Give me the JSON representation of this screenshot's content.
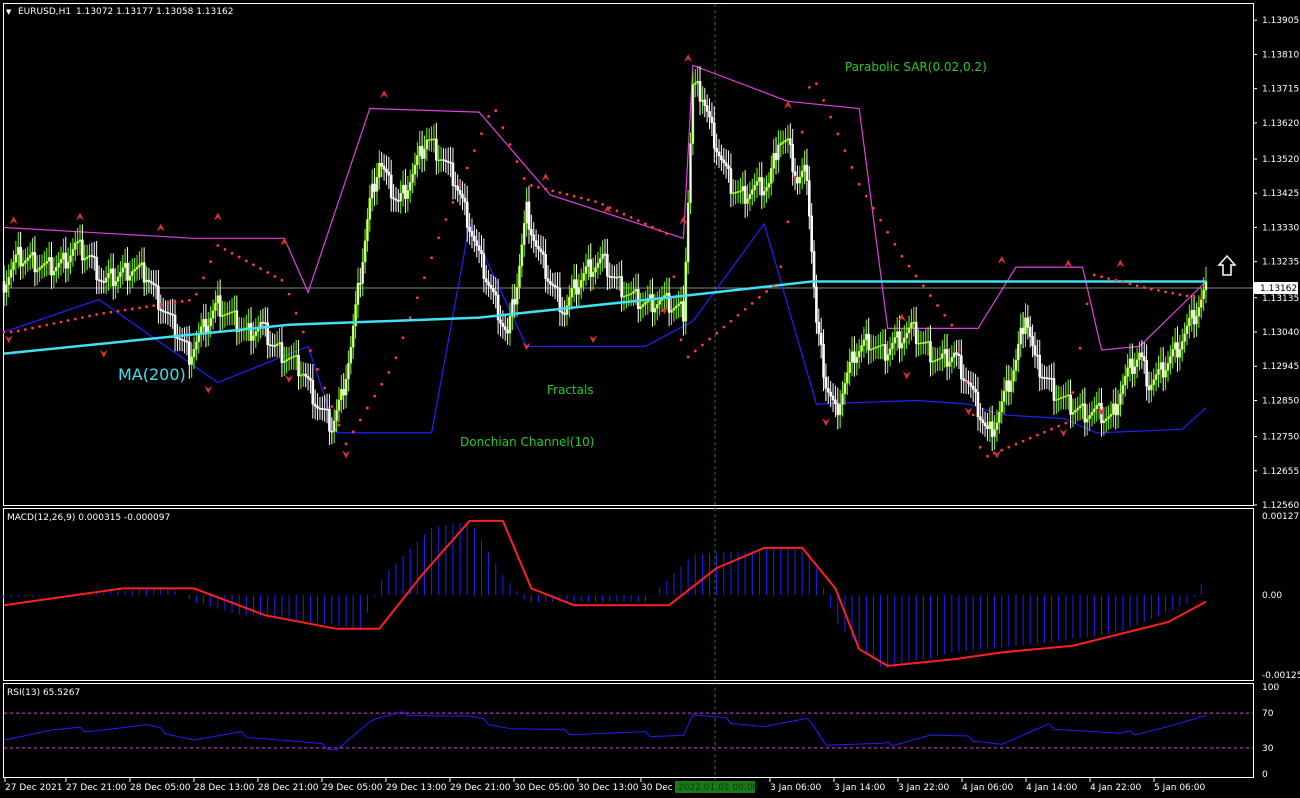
{
  "header": {
    "symbol": "EURUSD,H1",
    "ohlc": "1.13072 1.13177 1.13058 1.13162"
  },
  "colors": {
    "bull": "#7CFC00",
    "bear": "#FFFFFF",
    "ma": "#40E0F0",
    "sar": "#FF3B3B",
    "donchian_upper": "#E040E0",
    "donchian_lower": "#2020FF",
    "macd_hist": "#2020FF",
    "macd_signal": "#FF2020",
    "rsi": "#2020FF",
    "level": "#E040E0",
    "fractal": "#E03030",
    "label_green": "#22CC22",
    "grid_border": "#FFFFFF"
  },
  "chart_data": [
    {
      "type": "candlestick",
      "title": "EURUSD,H1",
      "ylim": [
        1.1256,
        1.1395
      ],
      "y_ticks": [
        "1.13905",
        "1.13810",
        "1.13715",
        "1.13620",
        "1.13520",
        "1.13425",
        "1.13330",
        "1.13235",
        "1.13135",
        "1.13040",
        "1.12945",
        "1.12850",
        "1.12750",
        "1.12655",
        "1.12560"
      ],
      "current_price": "1.13162",
      "x_ticks": [
        "27 Dec 2021",
        "27 Dec 21:00",
        "28 Dec 05:00",
        "28 Dec 13:00",
        "28 Dec 21:00",
        "29 Dec 05:00",
        "29 Dec 13:00",
        "29 Dec 21:00",
        "30 Dec 05:00",
        "30 Dec 13:00",
        "30 Dec",
        "3 Jan 06:00",
        "3 Jan 14:00",
        "3 Jan 22:00",
        "4 Jan 06:00",
        "4 Jan 14:00",
        "4 Jan 22:00",
        "5 Jan 06:00"
      ],
      "cursor_time": "2022.01.01 00:00",
      "indicator_labels": {
        "ma": "MA(200)",
        "sar": "Parabolic SAR(0.02,0.2)",
        "fractals": "Fractals",
        "donchian": "Donchian Channel(10)"
      },
      "close_path": [
        [
          0,
          1.1318
        ],
        [
          6,
          1.1325
        ],
        [
          12,
          1.1324
        ],
        [
          18,
          1.1322
        ],
        [
          24,
          1.1323
        ],
        [
          30,
          1.1328
        ],
        [
          36,
          1.1325
        ],
        [
          42,
          1.1318
        ],
        [
          48,
          1.132
        ],
        [
          54,
          1.1322
        ],
        [
          60,
          1.132
        ],
        [
          66,
          1.1312
        ],
        [
          72,
          1.1305
        ],
        [
          78,
          1.1298
        ],
        [
          84,
          1.1305
        ],
        [
          90,
          1.1312
        ],
        [
          96,
          1.1308
        ],
        [
          102,
          1.1304
        ],
        [
          108,
          1.1306
        ],
        [
          114,
          1.13
        ],
        [
          120,
          1.1297
        ],
        [
          126,
          1.1293
        ],
        [
          132,
          1.1284
        ],
        [
          138,
          1.1278
        ],
        [
          142,
          1.1286
        ],
        [
          146,
          1.13
        ],
        [
          150,
          1.132
        ],
        [
          154,
          1.134
        ],
        [
          158,
          1.1352
        ],
        [
          162,
          1.1345
        ],
        [
          166,
          1.134
        ],
        [
          172,
          1.1348
        ],
        [
          178,
          1.1358
        ],
        [
          184,
          1.1353
        ],
        [
          190,
          1.1346
        ],
        [
          196,
          1.1334
        ],
        [
          200,
          1.1325
        ],
        [
          206,
          1.1314
        ],
        [
          212,
          1.1303
        ],
        [
          216,
          1.1318
        ],
        [
          220,
          1.1338
        ],
        [
          224,
          1.1328
        ],
        [
          230,
          1.1318
        ],
        [
          236,
          1.131
        ],
        [
          240,
          1.1316
        ],
        [
          246,
          1.1322
        ],
        [
          252,
          1.1324
        ],
        [
          258,
          1.1318
        ],
        [
          264,
          1.1314
        ],
        [
          270,
          1.1312
        ],
        [
          276,
          1.1313
        ],
        [
          280,
          1.1312
        ],
        [
          286,
          1.131
        ],
        [
          290,
          1.1372
        ],
        [
          294,
          1.137
        ],
        [
          298,
          1.136
        ],
        [
          302,
          1.1352
        ],
        [
          306,
          1.1345
        ],
        [
          310,
          1.1342
        ],
        [
          316,
          1.1344
        ],
        [
          322,
          1.1345
        ],
        [
          326,
          1.1358
        ],
        [
          330,
          1.1356
        ],
        [
          334,
          1.1346
        ],
        [
          338,
          1.1349
        ],
        [
          342,
          1.1306
        ],
        [
          346,
          1.129
        ],
        [
          350,
          1.1282
        ],
        [
          354,
          1.129
        ],
        [
          358,
          1.1298
        ],
        [
          364,
          1.1302
        ],
        [
          370,
          1.1298
        ],
        [
          376,
          1.1302
        ],
        [
          382,
          1.1305
        ],
        [
          388,
          1.13
        ],
        [
          394,
          1.1296
        ],
        [
          400,
          1.1298
        ],
        [
          406,
          1.129
        ],
        [
          410,
          1.1283
        ],
        [
          414,
          1.1276
        ],
        [
          418,
          1.128
        ],
        [
          422,
          1.1288
        ],
        [
          426,
          1.1296
        ],
        [
          430,
          1.131
        ],
        [
          434,
          1.1296
        ],
        [
          438,
          1.1292
        ],
        [
          442,
          1.1288
        ],
        [
          448,
          1.1284
        ],
        [
          454,
          1.1282
        ],
        [
          460,
          1.1282
        ],
        [
          466,
          1.128
        ],
        [
          470,
          1.1288
        ],
        [
          474,
          1.1294
        ],
        [
          478,
          1.1298
        ],
        [
          482,
          1.129
        ],
        [
          486,
          1.1292
        ],
        [
          490,
          1.1296
        ],
        [
          494,
          1.13
        ],
        [
          498,
          1.1305
        ],
        [
          502,
          1.131
        ],
        [
          506,
          1.1316
        ]
      ],
      "ma200_path": [
        [
          0,
          1.1298
        ],
        [
          120,
          1.1306
        ],
        [
          200,
          1.1308
        ],
        [
          286,
          1.1314
        ],
        [
          340,
          1.1318
        ],
        [
          400,
          1.1318
        ],
        [
          506,
          1.1318
        ]
      ],
      "donchian_upper_path": [
        [
          0,
          1.1333
        ],
        [
          80,
          1.133
        ],
        [
          118,
          1.133
        ],
        [
          128,
          1.1315
        ],
        [
          154,
          1.1366
        ],
        [
          200,
          1.1365
        ],
        [
          230,
          1.1342
        ],
        [
          286,
          1.133
        ],
        [
          290,
          1.1378
        ],
        [
          330,
          1.1368
        ],
        [
          360,
          1.1366
        ],
        [
          372,
          1.1305
        ],
        [
          410,
          1.1305
        ],
        [
          426,
          1.1322
        ],
        [
          454,
          1.1322
        ],
        [
          462,
          1.1299
        ],
        [
          478,
          1.13
        ],
        [
          506,
          1.1318
        ]
      ],
      "donchian_lower_path": [
        [
          0,
          1.1304
        ],
        [
          40,
          1.1313
        ],
        [
          90,
          1.129
        ],
        [
          128,
          1.13
        ],
        [
          140,
          1.1276
        ],
        [
          180,
          1.1276
        ],
        [
          196,
          1.1334
        ],
        [
          220,
          1.13
        ],
        [
          270,
          1.13
        ],
        [
          290,
          1.1307
        ],
        [
          320,
          1.1334
        ],
        [
          342,
          1.1284
        ],
        [
          384,
          1.1285
        ],
        [
          406,
          1.1284
        ],
        [
          420,
          1.1281
        ],
        [
          446,
          1.128
        ],
        [
          460,
          1.1276
        ],
        [
          496,
          1.1277
        ],
        [
          506,
          1.1283
        ]
      ],
      "sar_path": [
        [
          4,
          1.1304
        ],
        [
          40,
          1.1309
        ],
        [
          80,
          1.1313
        ],
        [
          90,
          1.1328
        ],
        [
          118,
          1.1318
        ],
        [
          126,
          1.1304
        ],
        [
          144,
          1.1273
        ],
        [
          164,
          1.1295
        ],
        [
          184,
          1.1332
        ],
        [
          206,
          1.1367
        ],
        [
          220,
          1.1345
        ],
        [
          250,
          1.134
        ],
        [
          280,
          1.1331
        ],
        [
          286,
          1.1296
        ],
        [
          326,
          1.1318
        ],
        [
          340,
          1.1376
        ],
        [
          360,
          1.1345
        ],
        [
          378,
          1.1325
        ],
        [
          400,
          1.1305
        ],
        [
          412,
          1.1269
        ],
        [
          448,
          1.1279
        ],
        [
          458,
          1.132
        ],
        [
          482,
          1.1316
        ],
        [
          506,
          1.1313
        ]
      ],
      "fractals_up": [
        [
          4,
          1.1335
        ],
        [
          32,
          1.1336
        ],
        [
          66,
          1.1333
        ],
        [
          90,
          1.1336
        ],
        [
          118,
          1.1329
        ],
        [
          160,
          1.137
        ],
        [
          228,
          1.1347
        ],
        [
          254,
          1.1338
        ],
        [
          286,
          1.1335
        ],
        [
          288,
          1.138
        ],
        [
          330,
          1.1367
        ],
        [
          378,
          1.1308
        ],
        [
          420,
          1.1324
        ],
        [
          448,
          1.1323
        ],
        [
          470,
          1.1323
        ]
      ],
      "fractals_down": [
        [
          2,
          1.1302
        ],
        [
          42,
          1.1298
        ],
        [
          86,
          1.1288
        ],
        [
          120,
          1.1291
        ],
        [
          144,
          1.127
        ],
        [
          220,
          1.13
        ],
        [
          248,
          1.1302
        ],
        [
          278,
          1.131
        ],
        [
          346,
          1.1279
        ],
        [
          380,
          1.1292
        ],
        [
          406,
          1.1282
        ],
        [
          418,
          1.127
        ],
        [
          446,
          1.1276
        ],
        [
          462,
          1.1282
        ]
      ]
    },
    {
      "type": "line",
      "title": "MACD(12,26,9) 0.000315 -0.000097",
      "ylim": [
        -0.001259,
        0.001277
      ],
      "y_ticks": [
        "0.001277",
        "0.00",
        "-0.001259"
      ],
      "hist_path": [
        [
          0,
          -5e-05
        ],
        [
          40,
          5e-05
        ],
        [
          70,
          0.0001
        ],
        [
          80,
          -0.0001
        ],
        [
          100,
          -0.0003
        ],
        [
          130,
          -0.0004
        ],
        [
          150,
          -0.0005
        ],
        [
          160,
          0.0003
        ],
        [
          180,
          0.001
        ],
        [
          196,
          0.0011
        ],
        [
          210,
          0.0003
        ],
        [
          220,
          -0.0001
        ],
        [
          270,
          -0.0001
        ],
        [
          290,
          0.0006
        ],
        [
          330,
          0.0007
        ],
        [
          340,
          0.0006
        ],
        [
          350,
          -0.0004
        ],
        [
          370,
          -0.0011
        ],
        [
          400,
          -0.00085
        ],
        [
          440,
          -0.0007
        ],
        [
          470,
          -0.00055
        ],
        [
          500,
          -0.0001
        ],
        [
          506,
          0.0003
        ]
      ],
      "signal_path": [
        [
          0,
          -0.00015
        ],
        [
          50,
          0.0001
        ],
        [
          80,
          0.0001
        ],
        [
          110,
          -0.0003
        ],
        [
          140,
          -0.0005
        ],
        [
          158,
          -0.0005
        ],
        [
          176,
          0.0003
        ],
        [
          196,
          0.0011
        ],
        [
          210,
          0.0011
        ],
        [
          222,
          0.0001
        ],
        [
          240,
          -0.00015
        ],
        [
          280,
          -0.00015
        ],
        [
          300,
          0.0004
        ],
        [
          320,
          0.0007
        ],
        [
          336,
          0.0007
        ],
        [
          350,
          0.0001
        ],
        [
          360,
          -0.0008
        ],
        [
          372,
          -0.00105
        ],
        [
          400,
          -0.00095
        ],
        [
          420,
          -0.00085
        ],
        [
          450,
          -0.00075
        ],
        [
          490,
          -0.0004
        ],
        [
          506,
          -0.0001
        ]
      ]
    },
    {
      "type": "line",
      "title": "RSI(13) 65.5267",
      "ylim": [
        0,
        100
      ],
      "y_ticks": [
        "100",
        "70",
        "30",
        "0"
      ],
      "levels": [
        70,
        30
      ],
      "rsi_path": [
        [
          0,
          42
        ],
        [
          20,
          50
        ],
        [
          40,
          52
        ],
        [
          60,
          55
        ],
        [
          80,
          40
        ],
        [
          100,
          46
        ],
        [
          120,
          38
        ],
        [
          140,
          30
        ],
        [
          155,
          62
        ],
        [
          170,
          70
        ],
        [
          196,
          65
        ],
        [
          214,
          53
        ],
        [
          240,
          48
        ],
        [
          286,
          45
        ],
        [
          290,
          68
        ],
        [
          320,
          55
        ],
        [
          340,
          62
        ],
        [
          346,
          35
        ],
        [
          370,
          33
        ],
        [
          390,
          45
        ],
        [
          410,
          40
        ],
        [
          420,
          35
        ],
        [
          440,
          55
        ],
        [
          470,
          45
        ],
        [
          490,
          55
        ],
        [
          506,
          65
        ]
      ]
    }
  ]
}
